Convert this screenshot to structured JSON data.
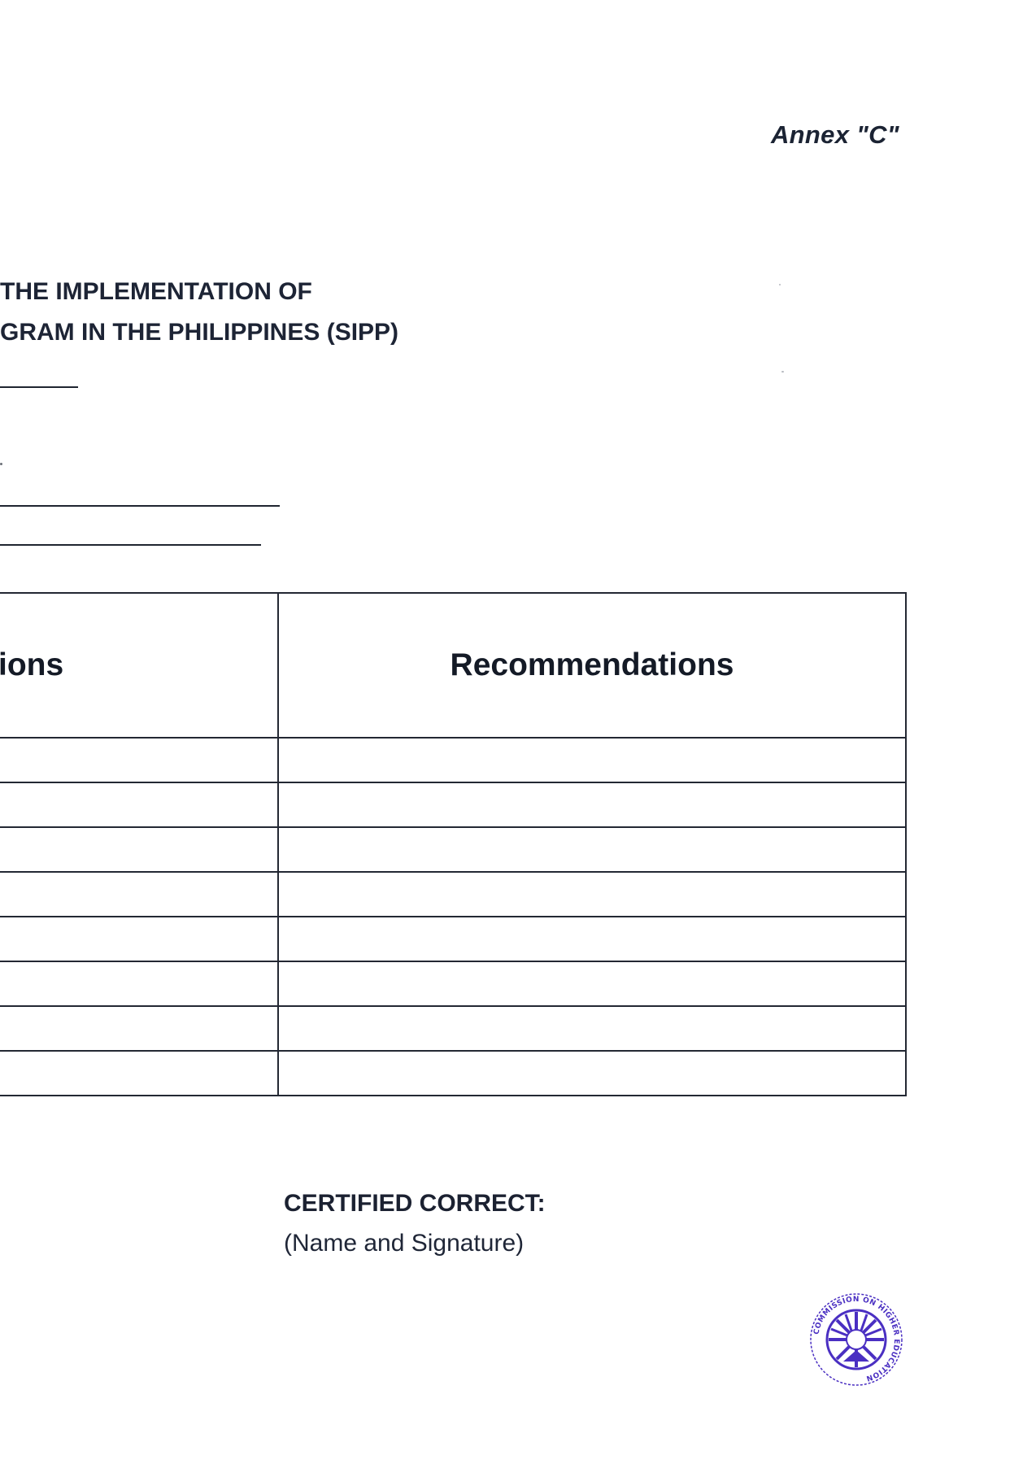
{
  "annex_label": "Annex \"C\"",
  "title": {
    "line1": "THE IMPLEMENTATION OF",
    "line2": "GRAM IN THE PHILIPPINES (SIPP)"
  },
  "table": {
    "headers": [
      "ions",
      "Recommendations"
    ],
    "rows": [
      [
        "",
        ""
      ],
      [
        "",
        ""
      ],
      [
        "",
        ""
      ],
      [
        "",
        ""
      ],
      [
        "",
        ""
      ],
      [
        "",
        ""
      ],
      [
        "",
        ""
      ],
      [
        "",
        ""
      ]
    ]
  },
  "certification": {
    "label": "CERTIFIED CORRECT:",
    "name_signature": "(Name and Signature)"
  },
  "seal": {
    "text": "COMMISSION ON HIGHER EDUCATION",
    "color": "#4a2fc2"
  }
}
